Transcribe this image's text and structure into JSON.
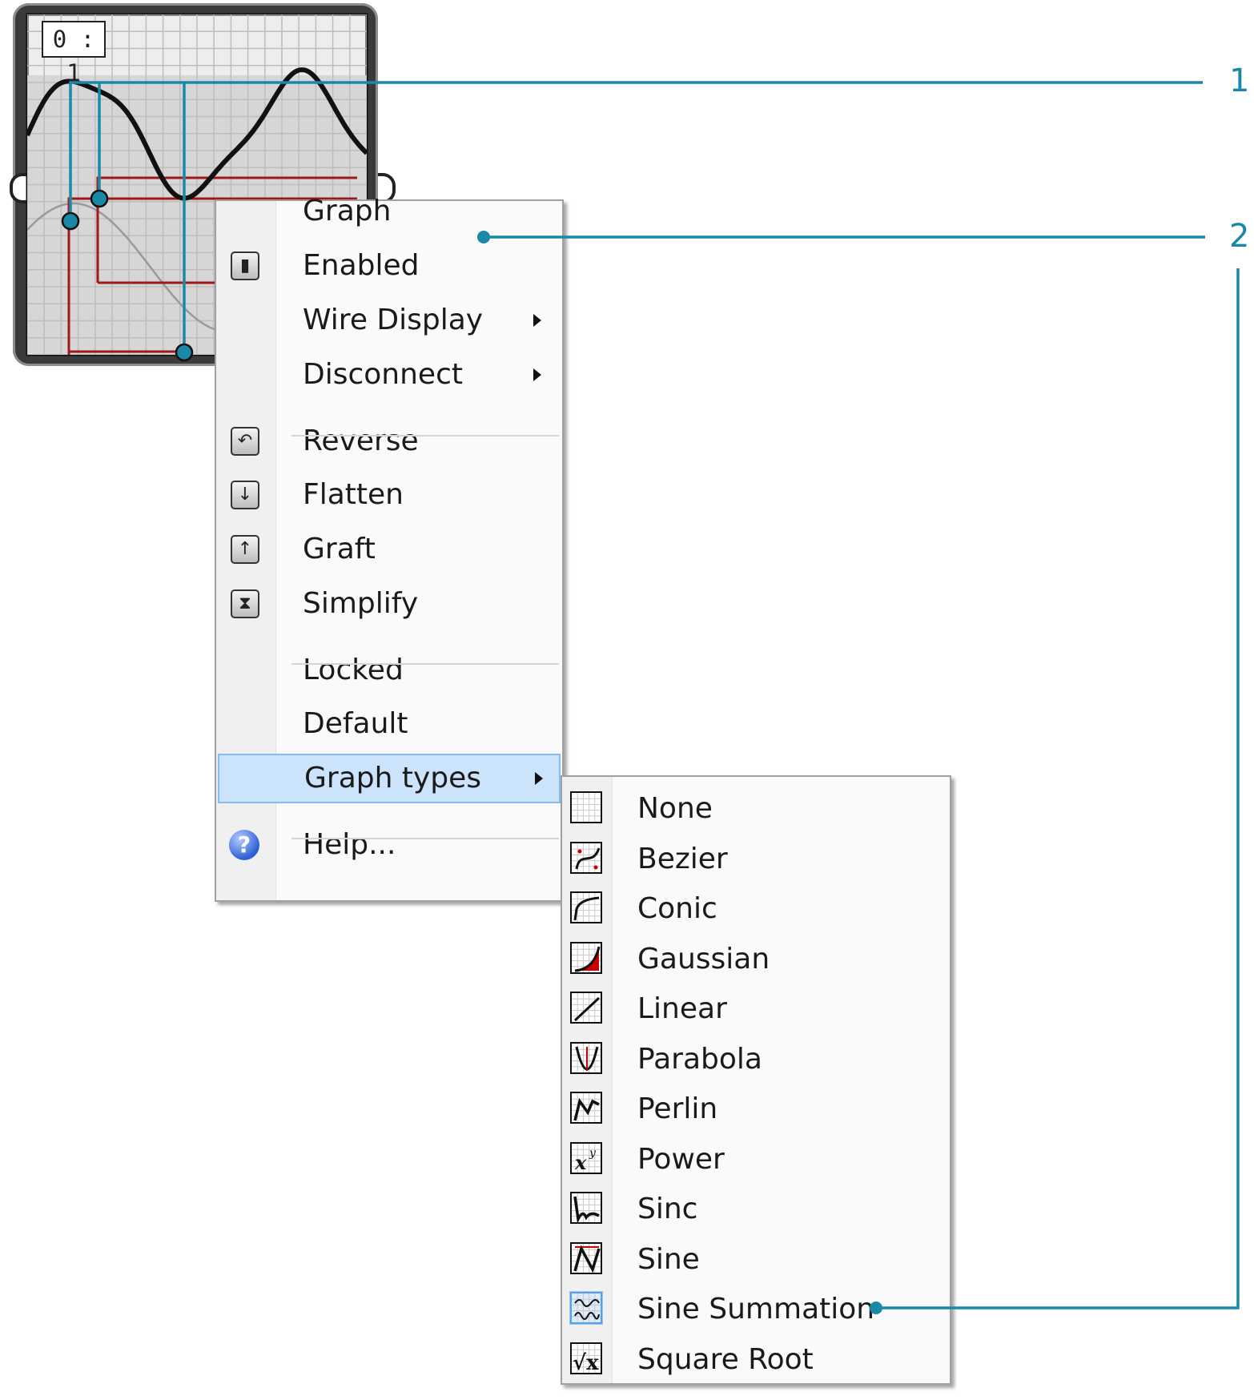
{
  "component": {
    "ratio_label": "0 : 1"
  },
  "context_menu": {
    "items": [
      {
        "label": "Graph"
      },
      {
        "label": "Enabled",
        "icon": "enabled-icon"
      },
      {
        "label": "Wire Display",
        "submenu": true
      },
      {
        "label": "Disconnect",
        "submenu": true
      },
      {
        "label": "Reverse",
        "icon": "reverse-icon"
      },
      {
        "label": "Flatten",
        "icon": "flatten-icon"
      },
      {
        "label": "Graft",
        "icon": "graft-icon"
      },
      {
        "label": "Simplify",
        "icon": "simplify-icon"
      },
      {
        "label": "Locked"
      },
      {
        "label": "Default"
      },
      {
        "label": "Graph types",
        "submenu": true,
        "highlighted": true
      },
      {
        "label": "Help...",
        "icon": "help-icon"
      }
    ]
  },
  "graph_types_submenu": {
    "items": [
      {
        "label": "None",
        "icon": "none-graph-icon"
      },
      {
        "label": "Bezier",
        "icon": "bezier-graph-icon"
      },
      {
        "label": "Conic",
        "icon": "conic-graph-icon"
      },
      {
        "label": "Gaussian",
        "icon": "gaussian-graph-icon"
      },
      {
        "label": "Linear",
        "icon": "linear-graph-icon"
      },
      {
        "label": "Parabola",
        "icon": "parabola-graph-icon"
      },
      {
        "label": "Perlin",
        "icon": "perlin-graph-icon"
      },
      {
        "label": "Power",
        "icon": "power-graph-icon"
      },
      {
        "label": "Sinc",
        "icon": "sinc-graph-icon"
      },
      {
        "label": "Sine",
        "icon": "sine-graph-icon"
      },
      {
        "label": "Sine Summation",
        "icon": "sine-summation-graph-icon",
        "selected": true
      },
      {
        "label": "Square Root",
        "icon": "square-root-graph-icon"
      }
    ]
  },
  "callouts": [
    {
      "number": "1"
    },
    {
      "number": "2"
    }
  ],
  "colors": {
    "callout": "#1a89a8",
    "highlight": "#cce4fb",
    "graph_curve": "#111111",
    "guide_red": "#a01818"
  }
}
